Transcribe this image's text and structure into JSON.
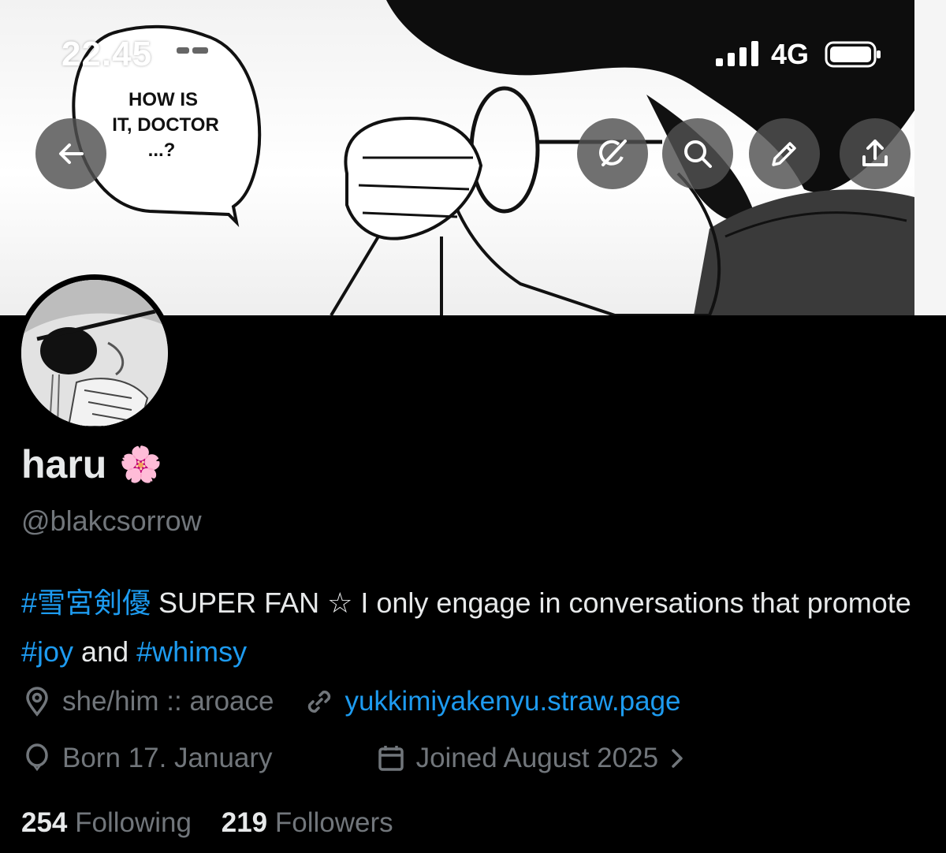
{
  "status_bar": {
    "time": "22.45",
    "network": "4G"
  },
  "banner": {
    "speech_bubble": [
      "HOW IS",
      "IT, DOCTOR",
      "...?"
    ]
  },
  "top_actions": {
    "back_icon": "arrow-left-icon",
    "grok_icon": "grok-icon",
    "search_icon": "search-icon",
    "edit_icon": "pencil-icon",
    "share_icon": "share-icon"
  },
  "profile": {
    "display_name": "haru",
    "emoji": "🌸",
    "handle": "@blakcsorrow",
    "bio": {
      "tag1": "#雪宮剣優",
      "text1": " SUPER FAN ☆ I only engage in conversations that promote ",
      "tag2": "#joy",
      "text2": " and ",
      "tag3": "#whimsy"
    },
    "location": "she/him :: aroace",
    "website": "yukkimiyakenyu.straw.page",
    "birthday": "Born 17. January",
    "joined": "Joined August 2025",
    "following_count": "254",
    "following_label": "Following",
    "followers_count": "219",
    "followers_label": "Followers"
  },
  "colors": {
    "accent": "#1d9bf0",
    "muted": "#71767b",
    "text": "#e7e9ea",
    "background": "#000000"
  }
}
